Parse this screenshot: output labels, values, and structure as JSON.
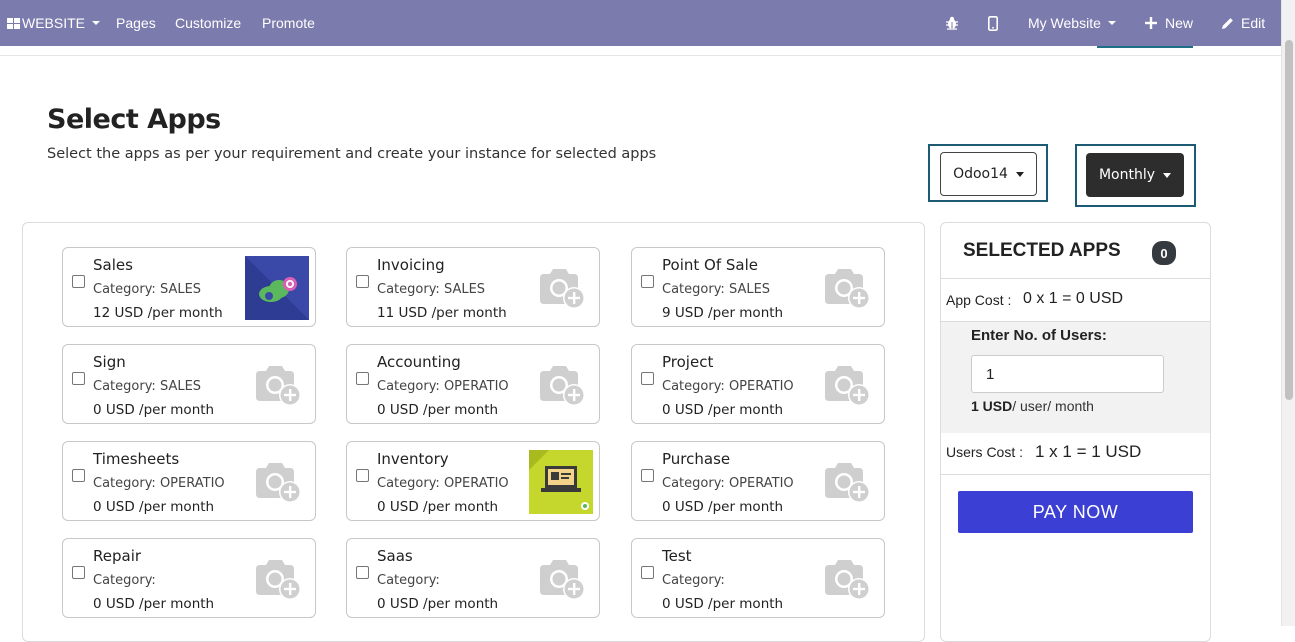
{
  "navbar": {
    "website_label": "WEBSITE",
    "pages_label": "Pages",
    "customize_label": "Customize",
    "promote_label": "Promote",
    "my_website_label": "My Website",
    "new_label": "New",
    "edit_label": "Edit",
    "bg_color": "#7c7bad"
  },
  "page": {
    "title": "Select Apps",
    "subtitle": "Select the apps as per your requirement and create your instance for selected apps"
  },
  "version_dropdown": {
    "value": "Odoo14"
  },
  "billing_dropdown": {
    "value": "Monthly"
  },
  "apps": [
    {
      "name": "Sales",
      "category": "Category: SALES",
      "price": "12 USD /per month",
      "icon": "sales-app-icon"
    },
    {
      "name": "Invoicing",
      "category": "Category: SALES",
      "price": "11 USD /per month",
      "icon": "camera-plus-icon"
    },
    {
      "name": "Point Of Sale",
      "category": "Category: SALES",
      "price": "9 USD /per month",
      "icon": "camera-plus-icon"
    },
    {
      "name": "Sign",
      "category": "Category: SALES",
      "price": "0 USD /per month",
      "icon": "camera-plus-icon"
    },
    {
      "name": "Accounting",
      "category": "Category: OPERATIO",
      "price": "0 USD /per month",
      "icon": "camera-plus-icon"
    },
    {
      "name": "Project",
      "category": "Category: OPERATIO",
      "price": "0 USD /per month",
      "icon": "camera-plus-icon"
    },
    {
      "name": "Timesheets",
      "category": "Category: OPERATIO",
      "price": "0 USD /per month",
      "icon": "camera-plus-icon"
    },
    {
      "name": "Inventory",
      "category": "Category: OPERATIO",
      "price": "0 USD /per month",
      "icon": "inventory-app-icon"
    },
    {
      "name": "Purchase",
      "category": "Category: OPERATIO",
      "price": "0 USD /per month",
      "icon": "camera-plus-icon"
    },
    {
      "name": "Repair",
      "category": "Category:",
      "price": "0 USD /per month",
      "icon": "camera-plus-icon"
    },
    {
      "name": "Saas",
      "category": "Category:",
      "price": "0 USD /per month",
      "icon": "camera-plus-icon"
    },
    {
      "name": "Test",
      "category": "Category:",
      "price": "0 USD /per month",
      "icon": "camera-plus-icon"
    }
  ],
  "summary": {
    "title": "SELECTED APPS",
    "count": "0",
    "app_cost_label": "App Cost :",
    "app_cost_value": "0 x 1 = 0 USD",
    "users_label": "Enter No. of Users:",
    "users_value": "1",
    "rate_bold": "1 USD",
    "rate_rest": "/ user/ month",
    "users_cost_label": "Users Cost :",
    "users_cost_value": "1 x 1 = 1 USD",
    "pay_label": "PAY NOW",
    "pay_color": "#3b3fd4"
  }
}
